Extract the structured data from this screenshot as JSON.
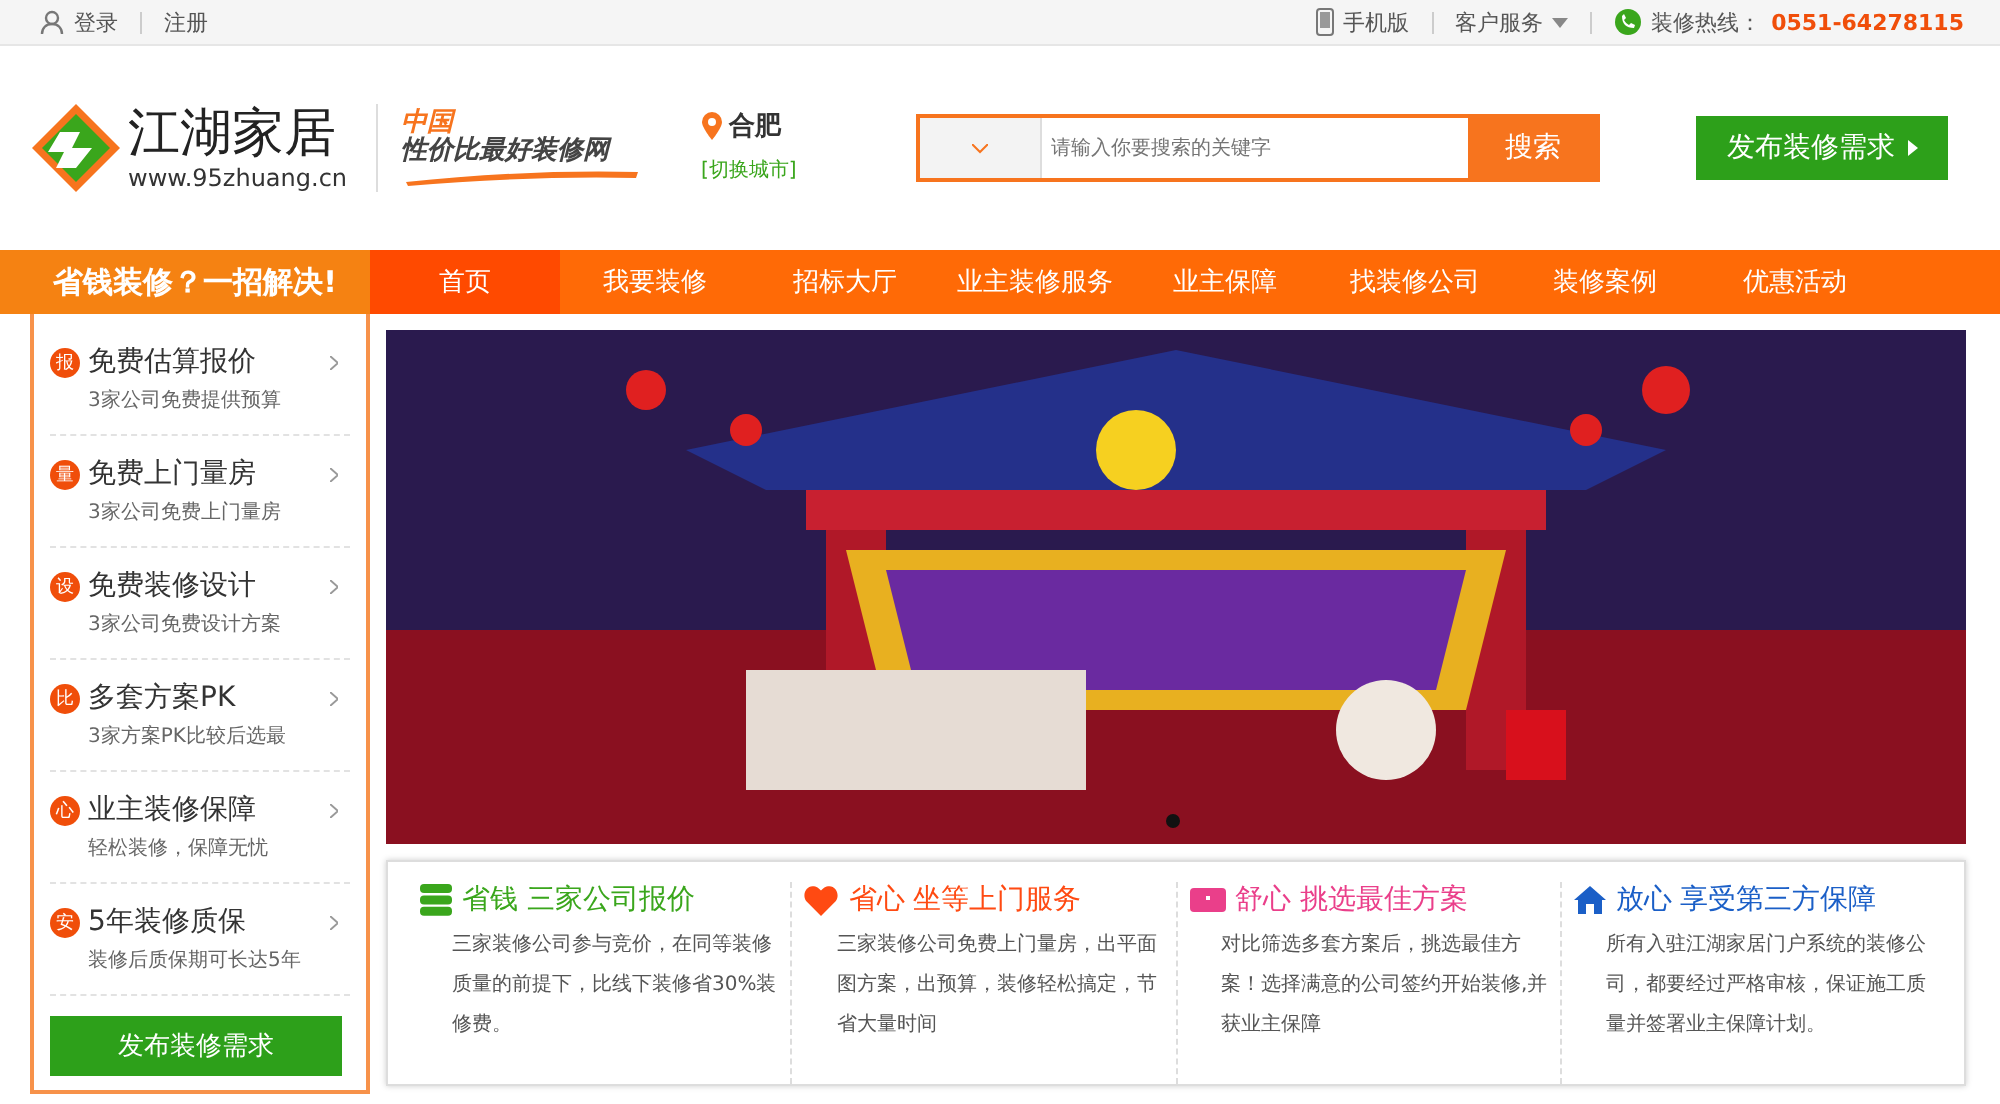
{
  "top_bar": {
    "login": "登录",
    "register": "注册",
    "mobile": "手机版",
    "service": "客户服务",
    "hotline_label": "装修热线：",
    "hotline": "0551-64278115"
  },
  "header": {
    "logo_name": "江湖家居",
    "logo_url": "www.95zhuang.cn",
    "slogan_top": "中国",
    "slogan": "性价比最好装修网",
    "city": "合肥",
    "switch_city": "[切换城市]",
    "search": {
      "placeholder": "请输入你要搜索的关键字",
      "button": "搜索"
    },
    "publish_button": "发布装修需求"
  },
  "side_title": "省钱装修？一招解决!",
  "nav": [
    {
      "label": "首页",
      "selected": true
    },
    {
      "label": "我要装修",
      "selected": false
    },
    {
      "label": "招标大厅",
      "selected": false
    },
    {
      "label": "业主装修服务",
      "selected": false
    },
    {
      "label": "业主保障",
      "selected": false
    },
    {
      "label": "找装修公司",
      "selected": false
    },
    {
      "label": "装修案例",
      "selected": false
    },
    {
      "label": "优惠活动",
      "selected": false
    }
  ],
  "sidebar": {
    "items": [
      {
        "badge": "报",
        "title": "免费估算报价",
        "desc": "3家公司免费提供预算"
      },
      {
        "badge": "量",
        "title": "免费上门量房",
        "desc": "3家公司免费上门量房"
      },
      {
        "badge": "设",
        "title": "免费装修设计",
        "desc": "3家公司免费设计方案"
      },
      {
        "badge": "比",
        "title": "多套方案PK",
        "desc": "3家方案PK比较后选最"
      },
      {
        "badge": "心",
        "title": "业主装修保障",
        "desc": "轻松装修，保障无忧"
      },
      {
        "badge": "安",
        "title": "5年装修质保",
        "desc": "装修后质保期可长达5年"
      }
    ],
    "button": "发布装修需求"
  },
  "features": [
    {
      "kind": "stack",
      "color": "#3aa61c",
      "title": "省钱 三家公司报价",
      "text": "三家装修公司参与竞价，在同等装修质量的前提下，比线下装修省30%装修费。"
    },
    {
      "kind": "heart",
      "color": "#ff4a12",
      "title": "省心 坐等上门服务",
      "text": "三家装修公司免费上门量房，出平面图方案，出预算，装修轻松搞定，节省大量时间"
    },
    {
      "kind": "card",
      "color": "#ea3f8a",
      "title": "舒心 挑选最佳方案",
      "text": "对比筛选多套方案后，挑选最佳方案！选择满意的公司签约开始装修,并获业主保障"
    },
    {
      "kind": "house",
      "color": "#1b5fc7",
      "title": "放心 享受第三方保障",
      "text": "所有入驻江湖家居门户系统的装修公司，都要经过严格审核，保证施工质量并签署业主保障计划。"
    }
  ]
}
